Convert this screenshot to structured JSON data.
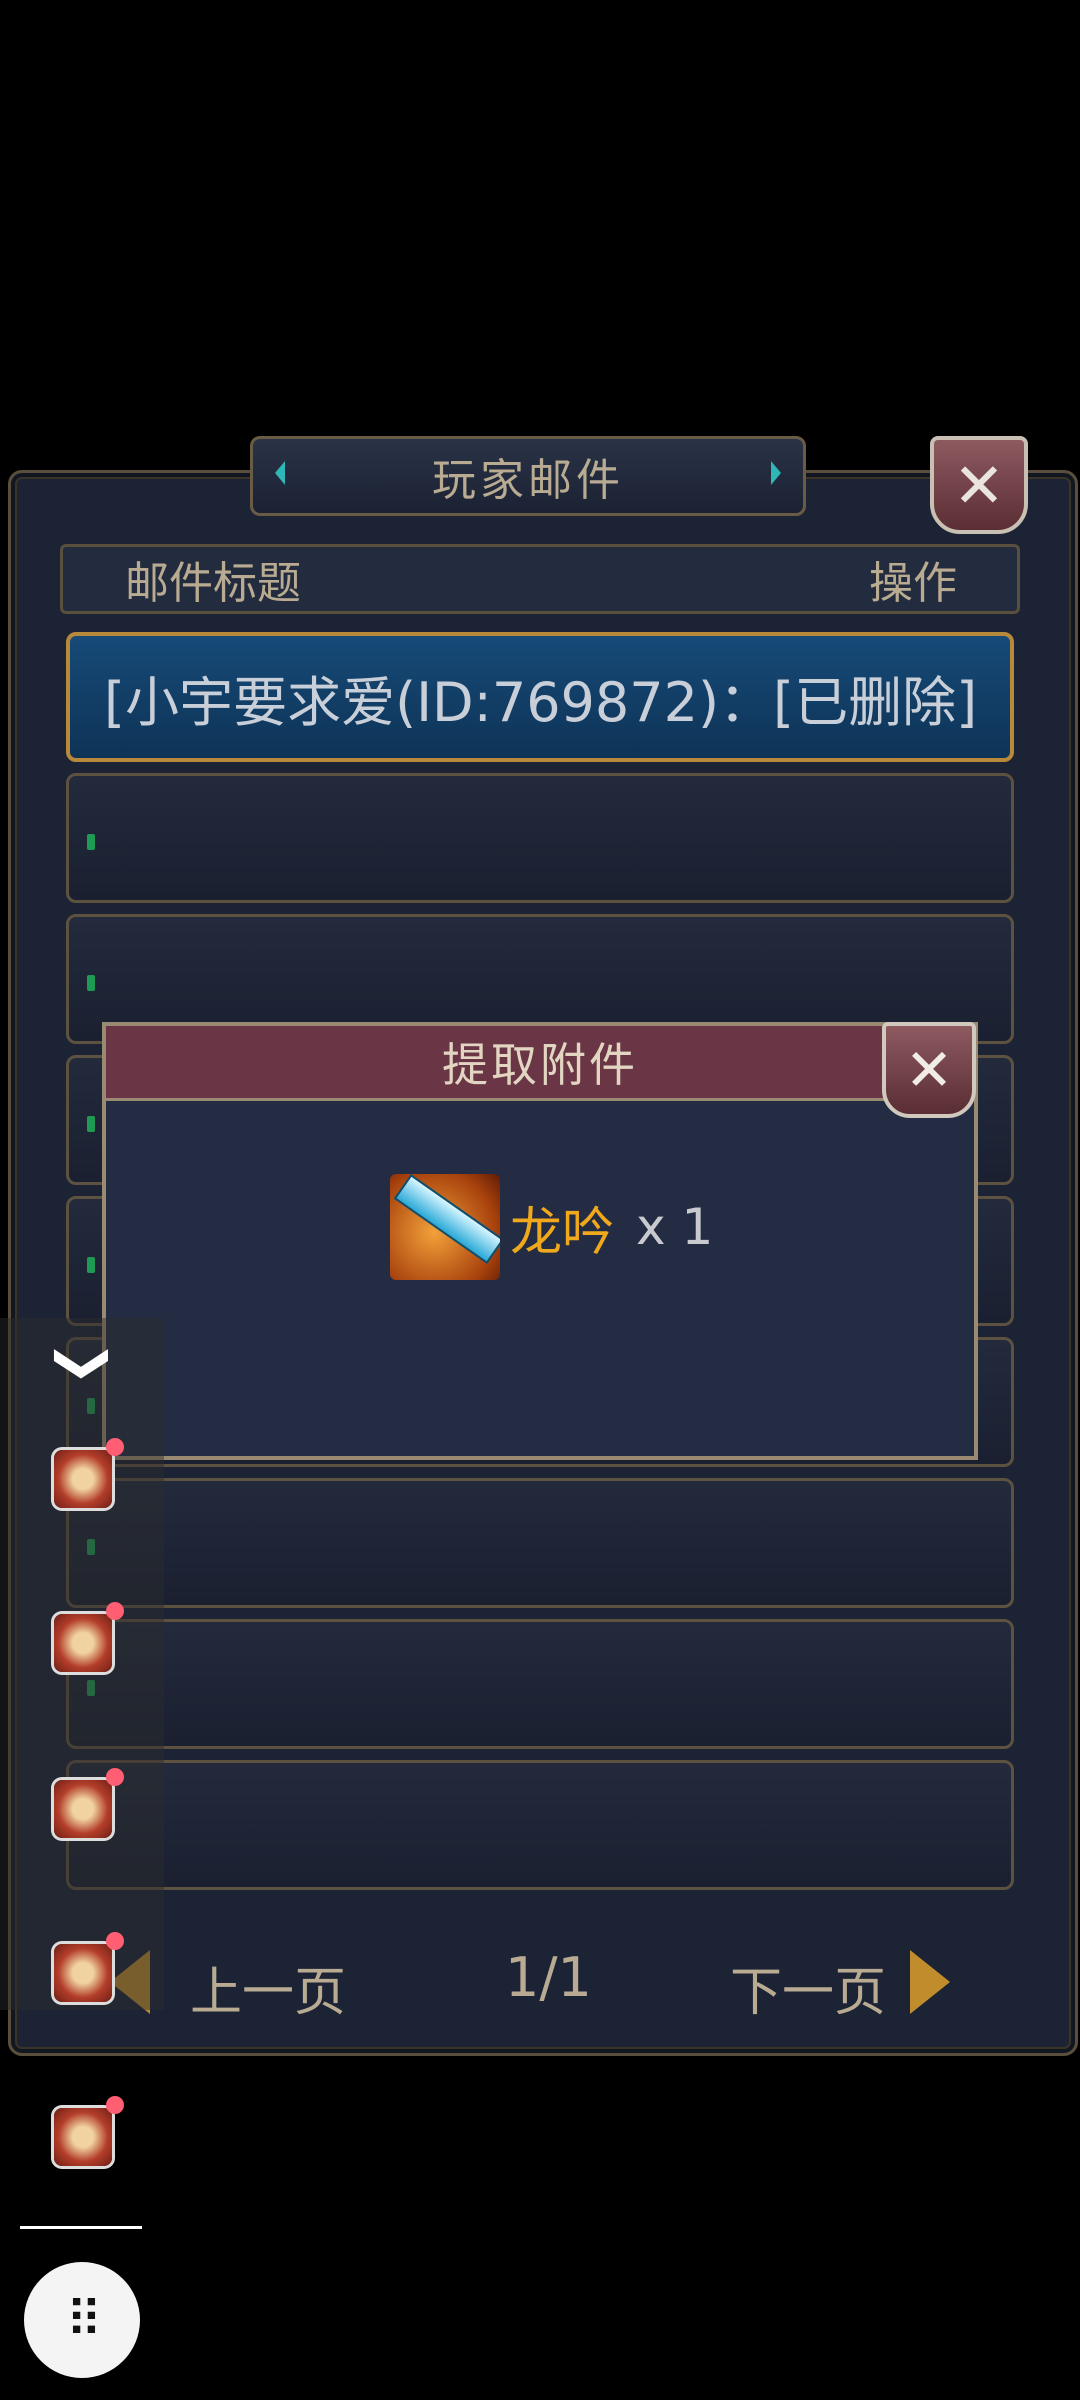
{
  "mail": {
    "title": "玩家邮件",
    "close": "✕",
    "columns": {
      "subject": "邮件标题",
      "action": "操作"
    },
    "rows": [
      {
        "text": "[小宇要求爱(ID:769872)：[已删除]"
      }
    ],
    "pager": {
      "prev": "上一页",
      "page": "1/1",
      "next": "下一页"
    }
  },
  "popup": {
    "title": "提取附件",
    "close": "✕",
    "item": {
      "name": "龙吟",
      "qty": "x 1",
      "icon": "sword-icon"
    }
  },
  "side_toolbar": {
    "chevron": "❮",
    "apps": [
      "app-icon",
      "app-icon",
      "app-icon",
      "app-icon",
      "app-icon"
    ]
  },
  "fab": {
    "label": "⠿"
  }
}
